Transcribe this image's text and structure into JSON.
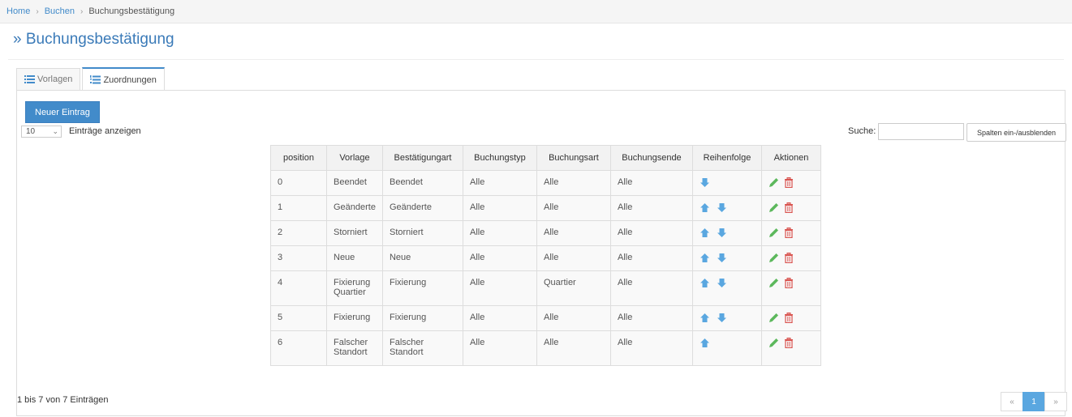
{
  "breadcrumb": {
    "home": "Home",
    "section": "Buchen",
    "current": "Buchungsbestätigung"
  },
  "page": {
    "title": "» Buchungsbestätigung"
  },
  "tabs": [
    {
      "label": "Vorlagen",
      "icon": "list-icon",
      "active": false
    },
    {
      "label": "Zuordnungen",
      "icon": "ordered-list-icon",
      "active": true
    }
  ],
  "toolbar": {
    "new_entry": "Neuer Eintrag",
    "page_length": "10",
    "length_label": "Einträge anzeigen",
    "search_label": "Suche:",
    "search_value": "",
    "columns_button": "Spalten ein-/ausblenden"
  },
  "table": {
    "headers": [
      "position",
      "Vorlage",
      "Bestätigungart",
      "Buchungstyp",
      "Buchungsart",
      "Buchungsende",
      "Reihenfolge",
      "Aktionen"
    ],
    "rows": [
      {
        "position": "0",
        "vorlage": "Beendet",
        "art": "Beendet",
        "typ": "Alle",
        "buchungsart": "Alle",
        "ende": "Alle",
        "up": false,
        "down": true
      },
      {
        "position": "1",
        "vorlage": "Geänderte",
        "art": "Geänderte",
        "typ": "Alle",
        "buchungsart": "Alle",
        "ende": "Alle",
        "up": true,
        "down": true
      },
      {
        "position": "2",
        "vorlage": "Storniert",
        "art": "Storniert",
        "typ": "Alle",
        "buchungsart": "Alle",
        "ende": "Alle",
        "up": true,
        "down": true
      },
      {
        "position": "3",
        "vorlage": "Neue",
        "art": "Neue",
        "typ": "Alle",
        "buchungsart": "Alle",
        "ende": "Alle",
        "up": true,
        "down": true
      },
      {
        "position": "4",
        "vorlage": "Fixierung Quartier",
        "art": "Fixierung",
        "typ": "Alle",
        "buchungsart": "Quartier",
        "ende": "Alle",
        "up": true,
        "down": true
      },
      {
        "position": "5",
        "vorlage": "Fixierung",
        "art": "Fixierung",
        "typ": "Alle",
        "buchungsart": "Alle",
        "ende": "Alle",
        "up": true,
        "down": true
      },
      {
        "position": "6",
        "vorlage": "Falscher Standort",
        "art": "Falscher Standort",
        "typ": "Alle",
        "buchungsart": "Alle",
        "ende": "Alle",
        "up": true,
        "down": false
      }
    ]
  },
  "footer": {
    "info": "1 bis 7 von 7 Einträgen",
    "pager": {
      "prev": "«",
      "page": "1",
      "next": "»"
    }
  },
  "colors": {
    "accent": "#428bca",
    "edit": "#5cb85c",
    "delete": "#d9534f",
    "arrow": "#5aa7e0"
  }
}
